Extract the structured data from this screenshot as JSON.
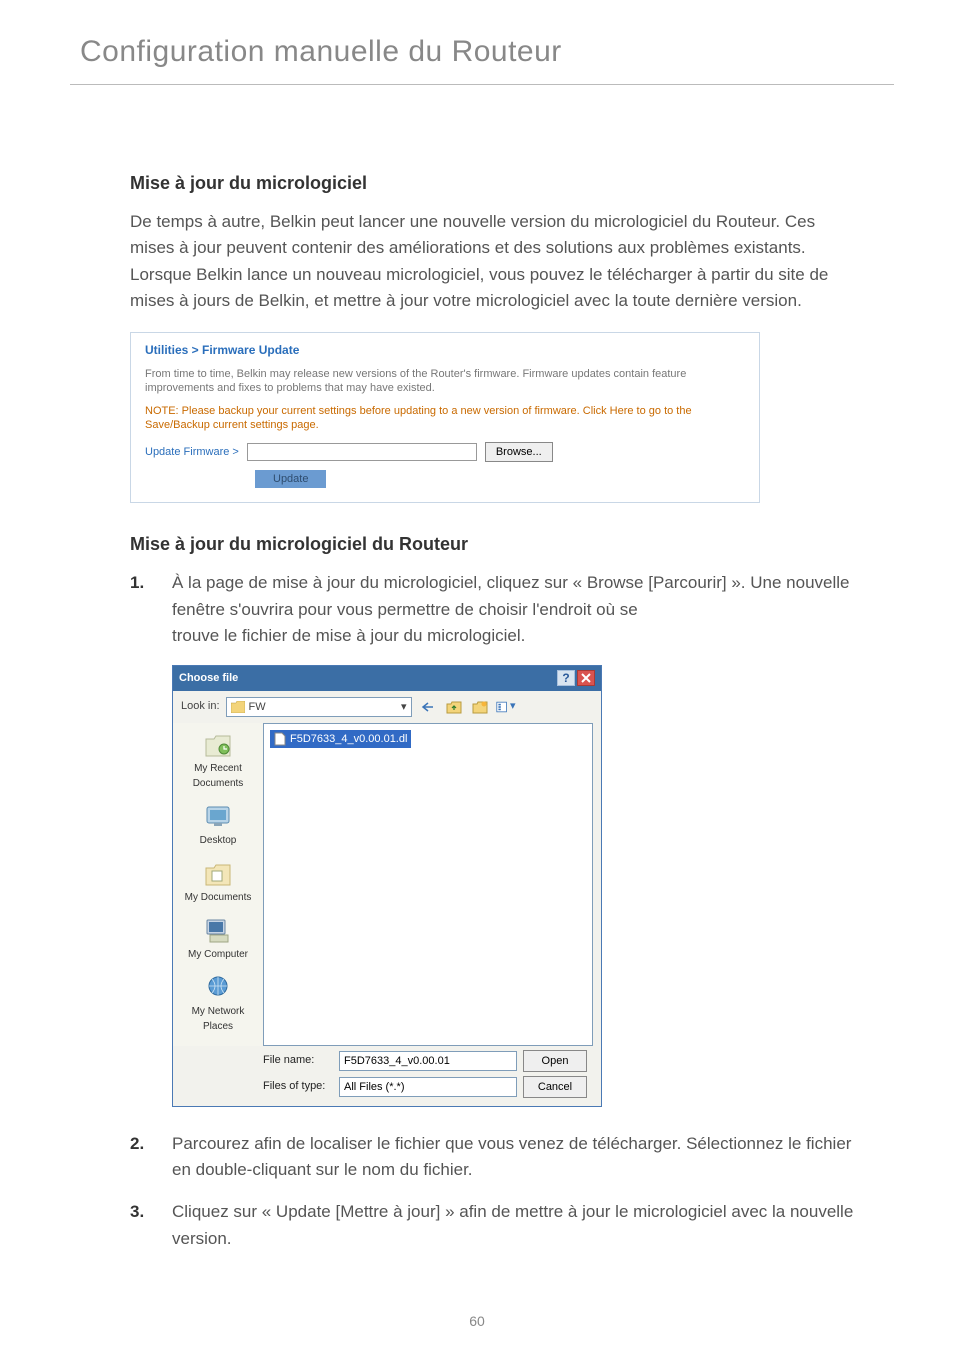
{
  "page": {
    "title": "Configuration manuelle du Routeur",
    "number": "60"
  },
  "section1_heading": "Mise à jour du micrologiciel",
  "section1_body": "De temps à autre, Belkin peut lancer une nouvelle version du micrologiciel du Routeur. Ces mises à jour peuvent contenir des améliorations et des solutions aux problèmes existants. Lorsque Belkin lance un nouveau micrologiciel, vous pouvez le télécharger à partir du site de mises à jours de Belkin, et mettre à jour votre micrologiciel avec la toute dernière version.",
  "fw_panel": {
    "title": "Utilities > Firmware Update",
    "desc": "From time to time, Belkin may release new versions of the Router's firmware. Firmware updates contain feature improvements and fixes to problems that may have existed.",
    "note": "NOTE: Please backup your current settings before updating to a new version of firmware. Click Here to go to the Save/Backup current settings page.",
    "update_label": "Update Firmware >",
    "browse_label": "Browse...",
    "update_btn": "Update"
  },
  "section2_heading": "Mise à jour du micrologiciel du Routeur",
  "steps": {
    "s1_num": "1.",
    "s1_text1": "À la page de mise à jour du micrologiciel, cliquez sur « Browse [Parcourir] ». Une nouvelle fenêtre s'ouvrira pour vous permettre de choisir l'endroit où se",
    "s1_text2": "trouve le fichier de mise à jour du micrologiciel.",
    "s2_num": "2.",
    "s2_text": "Parcourez afin de localiser le fichier que vous venez de télécharger. Sélectionnez le fichier en double-cliquant sur le nom du fichier.",
    "s3_num": "3.",
    "s3_text": "Cliquez sur « Update [Mettre à jour] » afin de mettre à jour le micrologiciel avec la nouvelle version."
  },
  "choose_dialog": {
    "title": "Choose file",
    "lookin_label": "Look in:",
    "lookin_value": "FW",
    "selected_file": "F5D7633_4_v0.00.01.dl",
    "sidebar": {
      "recent": "My Recent Documents",
      "desktop": "Desktop",
      "mydocs": "My Documents",
      "mycomp": "My Computer",
      "mynet": "My Network Places"
    },
    "filename_label": "File name:",
    "filename_value": "F5D7633_4_v0.00.01",
    "filetype_label": "Files of type:",
    "filetype_value": "All Files (*.*)",
    "open_btn": "Open",
    "cancel_btn": "Cancel"
  }
}
